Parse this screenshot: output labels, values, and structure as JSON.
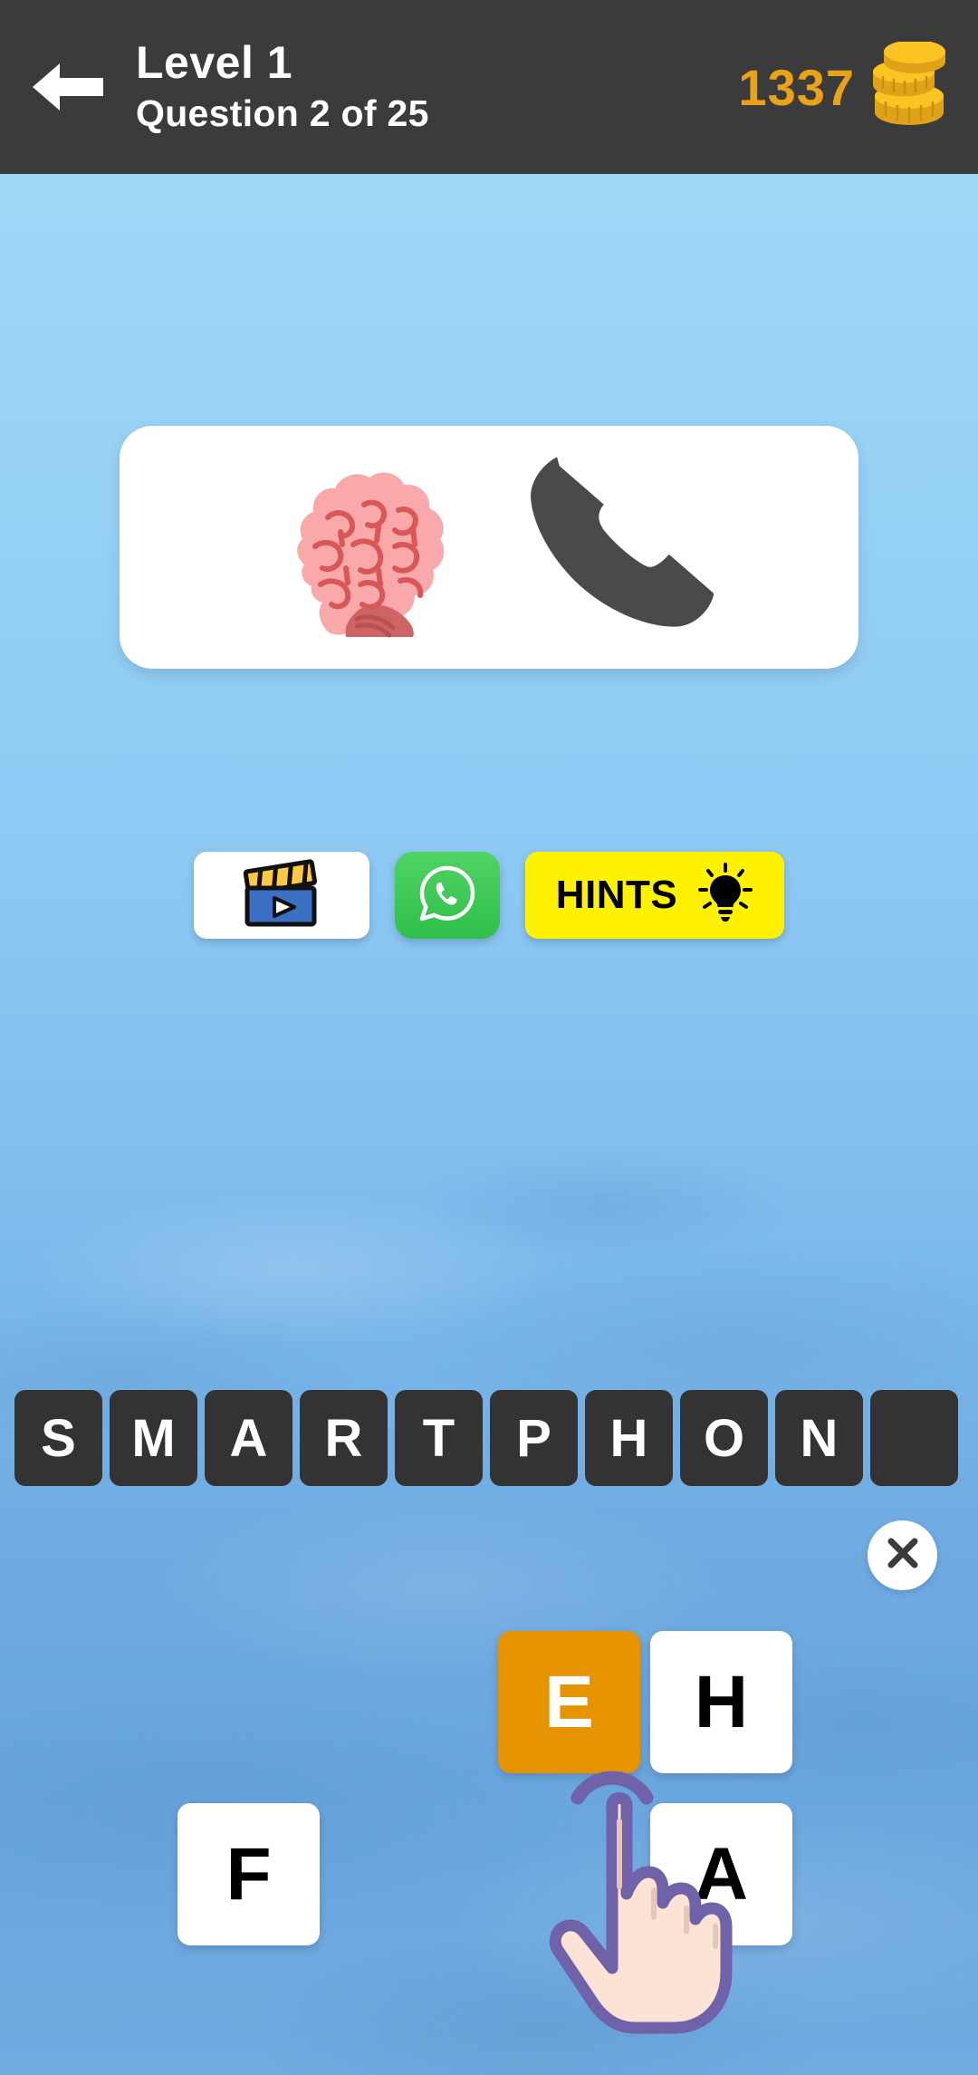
{
  "header": {
    "back_icon": "arrow-left-icon",
    "level_title": "Level 1",
    "question_title": "Question 2 of 25",
    "coin_count": "1337",
    "coin_icon": "coin-stack-icon",
    "background_color": "#3b3b3b",
    "coin_color": "#e8a317"
  },
  "puzzle": {
    "emoji_1": "brain-emoji",
    "emoji_2": "telephone-receiver-emoji",
    "card_color": "#ffffff"
  },
  "actions": {
    "video_label": "",
    "video_icon": "clapperboard-video-icon",
    "whatsapp_icon": "whatsapp-icon",
    "whatsapp_color": "#2fbf4a",
    "hints_label": "HINTS",
    "hints_icon": "lightbulb-icon",
    "hints_color": "#fff200"
  },
  "answer": {
    "word": "SMARTPHONE",
    "slots": [
      "S",
      "M",
      "A",
      "R",
      "T",
      "P",
      "H",
      "O",
      "N",
      ""
    ],
    "slot_color": "#333333"
  },
  "close": {
    "icon": "close-x-icon",
    "label": ""
  },
  "letters": [
    {
      "char": "E",
      "state": "active",
      "color": "#e59400"
    },
    {
      "char": "H",
      "state": "default",
      "color": "#ffffff"
    },
    {
      "char": "F",
      "state": "default",
      "color": "#ffffff"
    },
    {
      "char": "A",
      "state": "default",
      "color": "#ffffff"
    }
  ],
  "cursor": {
    "icon": "pointing-hand-tap-cursor",
    "outline_color": "#6f62a8",
    "fill_color": "#fbe3d6"
  },
  "background": {
    "top_color": "#a3daf8",
    "bottom_color": "#6aa6de"
  }
}
